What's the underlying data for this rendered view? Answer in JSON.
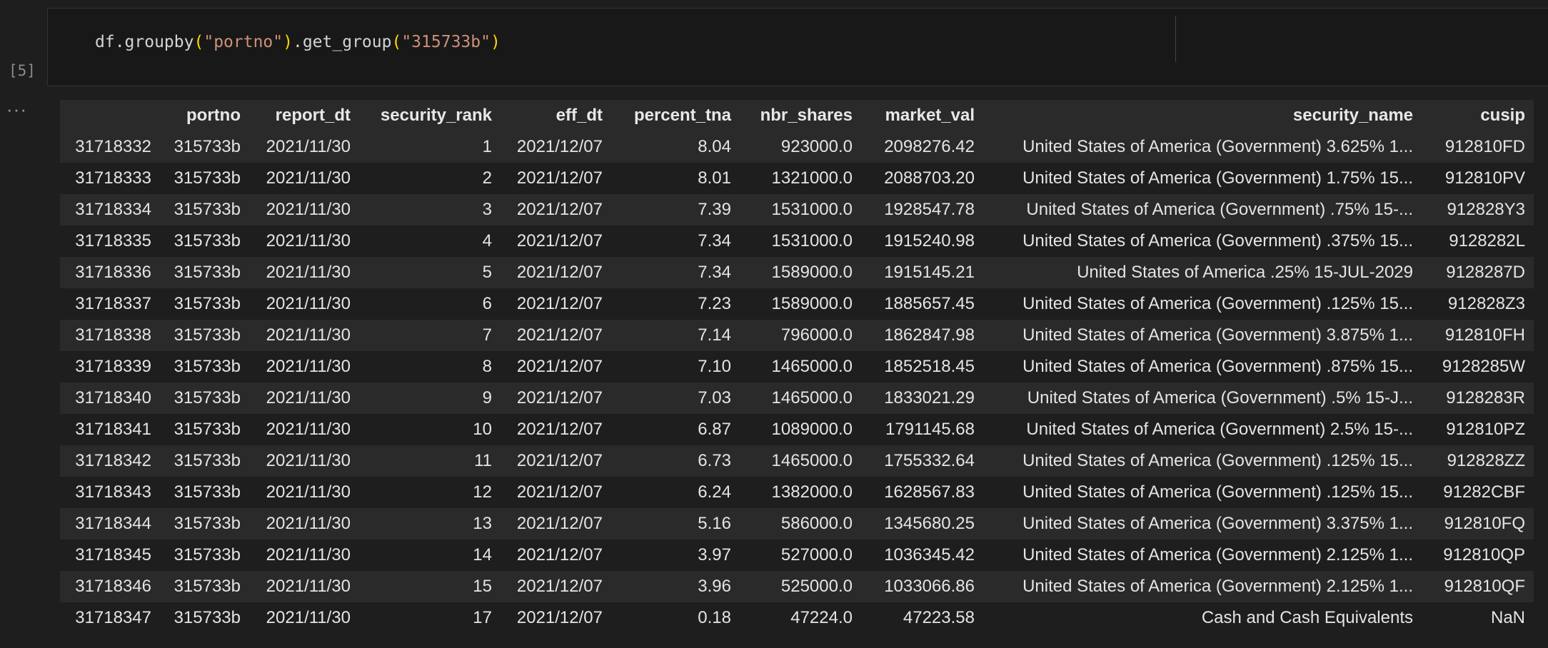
{
  "cell": {
    "execution_count": "[5]",
    "code": {
      "prefix": "df.groupby",
      "open1": "(",
      "arg1": "\"portno\"",
      "close1": ")",
      "method": ".get_group",
      "open2": "(",
      "arg2": "\"315733b\"",
      "close2": ")"
    },
    "output_menu": "···"
  },
  "dataframe": {
    "columns": [
      "",
      "portno",
      "report_dt",
      "security_rank",
      "eff_dt",
      "percent_tna",
      "nbr_shares",
      "market_val",
      "security_name",
      "cusip"
    ],
    "rows": [
      [
        "31718332",
        "315733b",
        "2021/11/30",
        "1",
        "2021/12/07",
        "8.04",
        "923000.0",
        "2098276.42",
        "United States of America (Government) 3.625% 1...",
        "912810FD"
      ],
      [
        "31718333",
        "315733b",
        "2021/11/30",
        "2",
        "2021/12/07",
        "8.01",
        "1321000.0",
        "2088703.20",
        "United States of America (Government) 1.75% 15...",
        "912810PV"
      ],
      [
        "31718334",
        "315733b",
        "2021/11/30",
        "3",
        "2021/12/07",
        "7.39",
        "1531000.0",
        "1928547.78",
        "United States of America (Government) .75% 15-...",
        "912828Y3"
      ],
      [
        "31718335",
        "315733b",
        "2021/11/30",
        "4",
        "2021/12/07",
        "7.34",
        "1531000.0",
        "1915240.98",
        "United States of America (Government) .375% 15...",
        "9128282L"
      ],
      [
        "31718336",
        "315733b",
        "2021/11/30",
        "5",
        "2021/12/07",
        "7.34",
        "1589000.0",
        "1915145.21",
        "United States of America .25% 15-JUL-2029",
        "9128287D"
      ],
      [
        "31718337",
        "315733b",
        "2021/11/30",
        "6",
        "2021/12/07",
        "7.23",
        "1589000.0",
        "1885657.45",
        "United States of America (Government) .125% 15...",
        "912828Z3"
      ],
      [
        "31718338",
        "315733b",
        "2021/11/30",
        "7",
        "2021/12/07",
        "7.14",
        "796000.0",
        "1862847.98",
        "United States of America (Government) 3.875% 1...",
        "912810FH"
      ],
      [
        "31718339",
        "315733b",
        "2021/11/30",
        "8",
        "2021/12/07",
        "7.10",
        "1465000.0",
        "1852518.45",
        "United States of America (Government) .875% 15...",
        "9128285W"
      ],
      [
        "31718340",
        "315733b",
        "2021/11/30",
        "9",
        "2021/12/07",
        "7.03",
        "1465000.0",
        "1833021.29",
        "United States of America (Government) .5% 15-J...",
        "9128283R"
      ],
      [
        "31718341",
        "315733b",
        "2021/11/30",
        "10",
        "2021/12/07",
        "6.87",
        "1089000.0",
        "1791145.68",
        "United States of America (Government) 2.5% 15-...",
        "912810PZ"
      ],
      [
        "31718342",
        "315733b",
        "2021/11/30",
        "11",
        "2021/12/07",
        "6.73",
        "1465000.0",
        "1755332.64",
        "United States of America (Government) .125% 15...",
        "912828ZZ"
      ],
      [
        "31718343",
        "315733b",
        "2021/11/30",
        "12",
        "2021/12/07",
        "6.24",
        "1382000.0",
        "1628567.83",
        "United States of America (Government) .125% 15...",
        "91282CBF"
      ],
      [
        "31718344",
        "315733b",
        "2021/11/30",
        "13",
        "2021/12/07",
        "5.16",
        "586000.0",
        "1345680.25",
        "United States of America (Government) 3.375% 1...",
        "912810FQ"
      ],
      [
        "31718345",
        "315733b",
        "2021/11/30",
        "14",
        "2021/12/07",
        "3.97",
        "527000.0",
        "1036345.42",
        "United States of America (Government) 2.125% 1...",
        "912810QP"
      ],
      [
        "31718346",
        "315733b",
        "2021/11/30",
        "15",
        "2021/12/07",
        "3.96",
        "525000.0",
        "1033066.86",
        "United States of America (Government) 2.125% 1...",
        "912810QF"
      ],
      [
        "31718347",
        "315733b",
        "2021/11/30",
        "17",
        "2021/12/07",
        "0.18",
        "47224.0",
        "47223.58",
        "Cash and Cash Equivalents",
        "NaN"
      ]
    ]
  },
  "colors": {
    "background": "#1e1e1e",
    "row_stripe": "#2a2a2a",
    "string_token": "#ce9178",
    "paren_token": "#ffd700"
  }
}
